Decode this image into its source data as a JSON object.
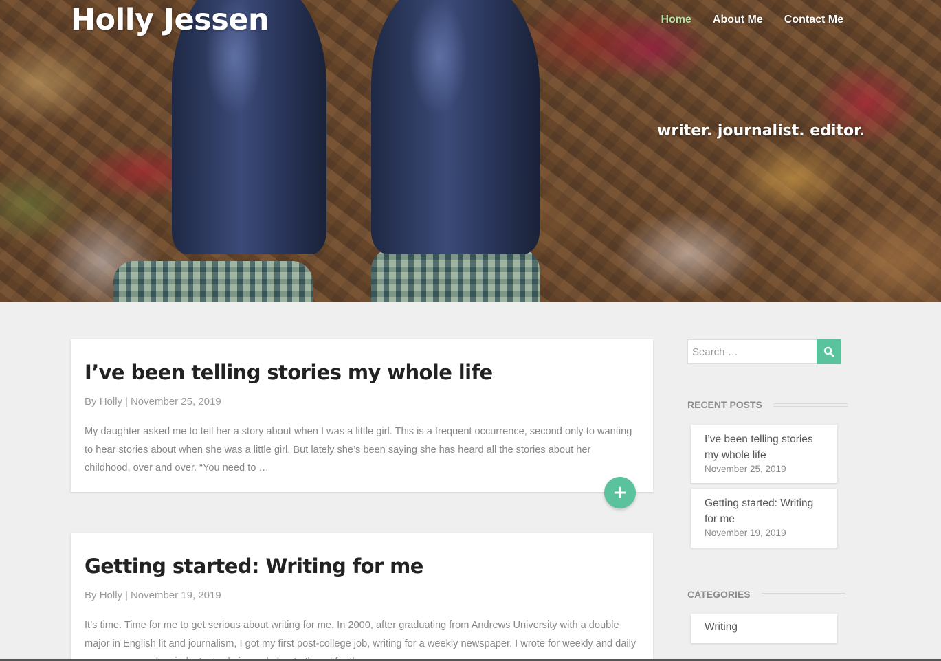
{
  "site": {
    "title": "Holly Jessen",
    "tagline": "writer. journalist. editor."
  },
  "nav": {
    "items": [
      {
        "label": "Home",
        "active": true
      },
      {
        "label": "About Me",
        "active": false
      },
      {
        "label": "Contact Me",
        "active": false
      }
    ]
  },
  "posts": [
    {
      "title": "I’ve been telling stories my whole life",
      "author_prefix": "By",
      "author": "Holly",
      "separator": "|",
      "date": "November 25, 2019",
      "excerpt": "My daughter asked me to tell her a story about when I was a little girl. This is a frequent occurrence, second only to wanting to hear stories about when she was a little girl. But lately she’s been saying she has heard all the stories about her childhood, over and over. “You need to …",
      "more_button": "+"
    },
    {
      "title": "Getting started: Writing for me",
      "author_prefix": "By",
      "author": "Holly",
      "separator": "|",
      "date": "November 19, 2019",
      "excerpt": "It’s time. Time for me to get serious about writing for me. In 2000, after graduating from Andrews University with a double major in English lit and journalism, I got my first post-college job, writing for a weekly newspaper. I wrote for weekly and daily newspapers and an industry trade journal about ethanol for the …"
    }
  ],
  "sidebar": {
    "search": {
      "placeholder": "Search …",
      "value": ""
    },
    "recent_posts": {
      "heading": "RECENT POSTS",
      "items": [
        {
          "title": "I’ve been telling stories my whole life",
          "date": "November 25, 2019"
        },
        {
          "title": "Getting started: Writing for me",
          "date": "November 19, 2019"
        }
      ]
    },
    "categories": {
      "heading": "CATEGORIES",
      "items": [
        {
          "label": "Writing"
        }
      ]
    }
  },
  "colors": {
    "accent": "#5ac29c",
    "nav_active": "#b6e0a0",
    "page_bg": "#efefef"
  }
}
